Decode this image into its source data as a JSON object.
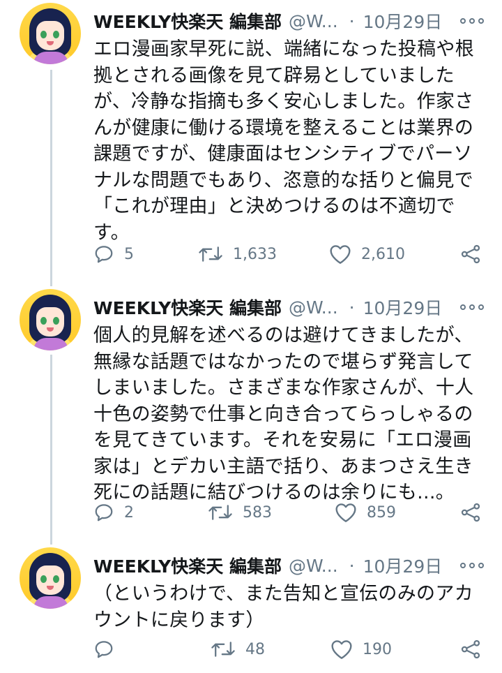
{
  "tweets": [
    {
      "author_name": "WEEKLY快楽天 編集部",
      "handle": "@W...",
      "separator": "·",
      "date": "10月29日",
      "text": "エロ漫画家早死に説、端緒になった投稿や根\n拠とされる画像を見て辟易としていました\nが、冷静な指摘も多く安心しました。作家さ\nんが健康に働ける環境を整えることは業界の\n課題ですが、健康面はセンシティブでパーソ\nナルな問題でもあり、恣意的な括りと偏見で\n「これが理由」と決めつけるのは不適切で\nす。",
      "replies": "5",
      "retweets": "1,633",
      "likes": "2,610"
    },
    {
      "author_name": "WEEKLY快楽天 編集部",
      "handle": "@W...",
      "separator": "·",
      "date": "10月29日",
      "text": "個人的見解を述べるのは避けてきましたが、\n無縁な話題ではなかったので堪らず発言して\nしまいました。さまざまな作家さんが、十人\n十色の姿勢で仕事と向き合ってらっしゃるの\nを見てきています。それを安易に「エロ漫画\n家は」とデカい主語で括り、あまつさえ生き\n死にの話題に結びつけるのは余りにも...。",
      "replies": "2",
      "retweets": "583",
      "likes": "859"
    },
    {
      "author_name": "WEEKLY快楽天 編集部",
      "handle": "@W...",
      "separator": "·",
      "date": "10月29日",
      "text": "（というわけで、また告知と宣伝のみのアカ\nウントに戻ります）",
      "replies": "",
      "retweets": "48",
      "likes": "190"
    }
  ],
  "colors": {
    "text": "#14171a",
    "secondary": "#657786",
    "thread_line": "#ccd6dd",
    "avatar_bg": "#ffd94a"
  },
  "icons": {
    "reply": "reply-icon",
    "retweet": "retweet-icon",
    "like": "heart-icon",
    "share": "share-icon",
    "more": "more-options-icon"
  }
}
